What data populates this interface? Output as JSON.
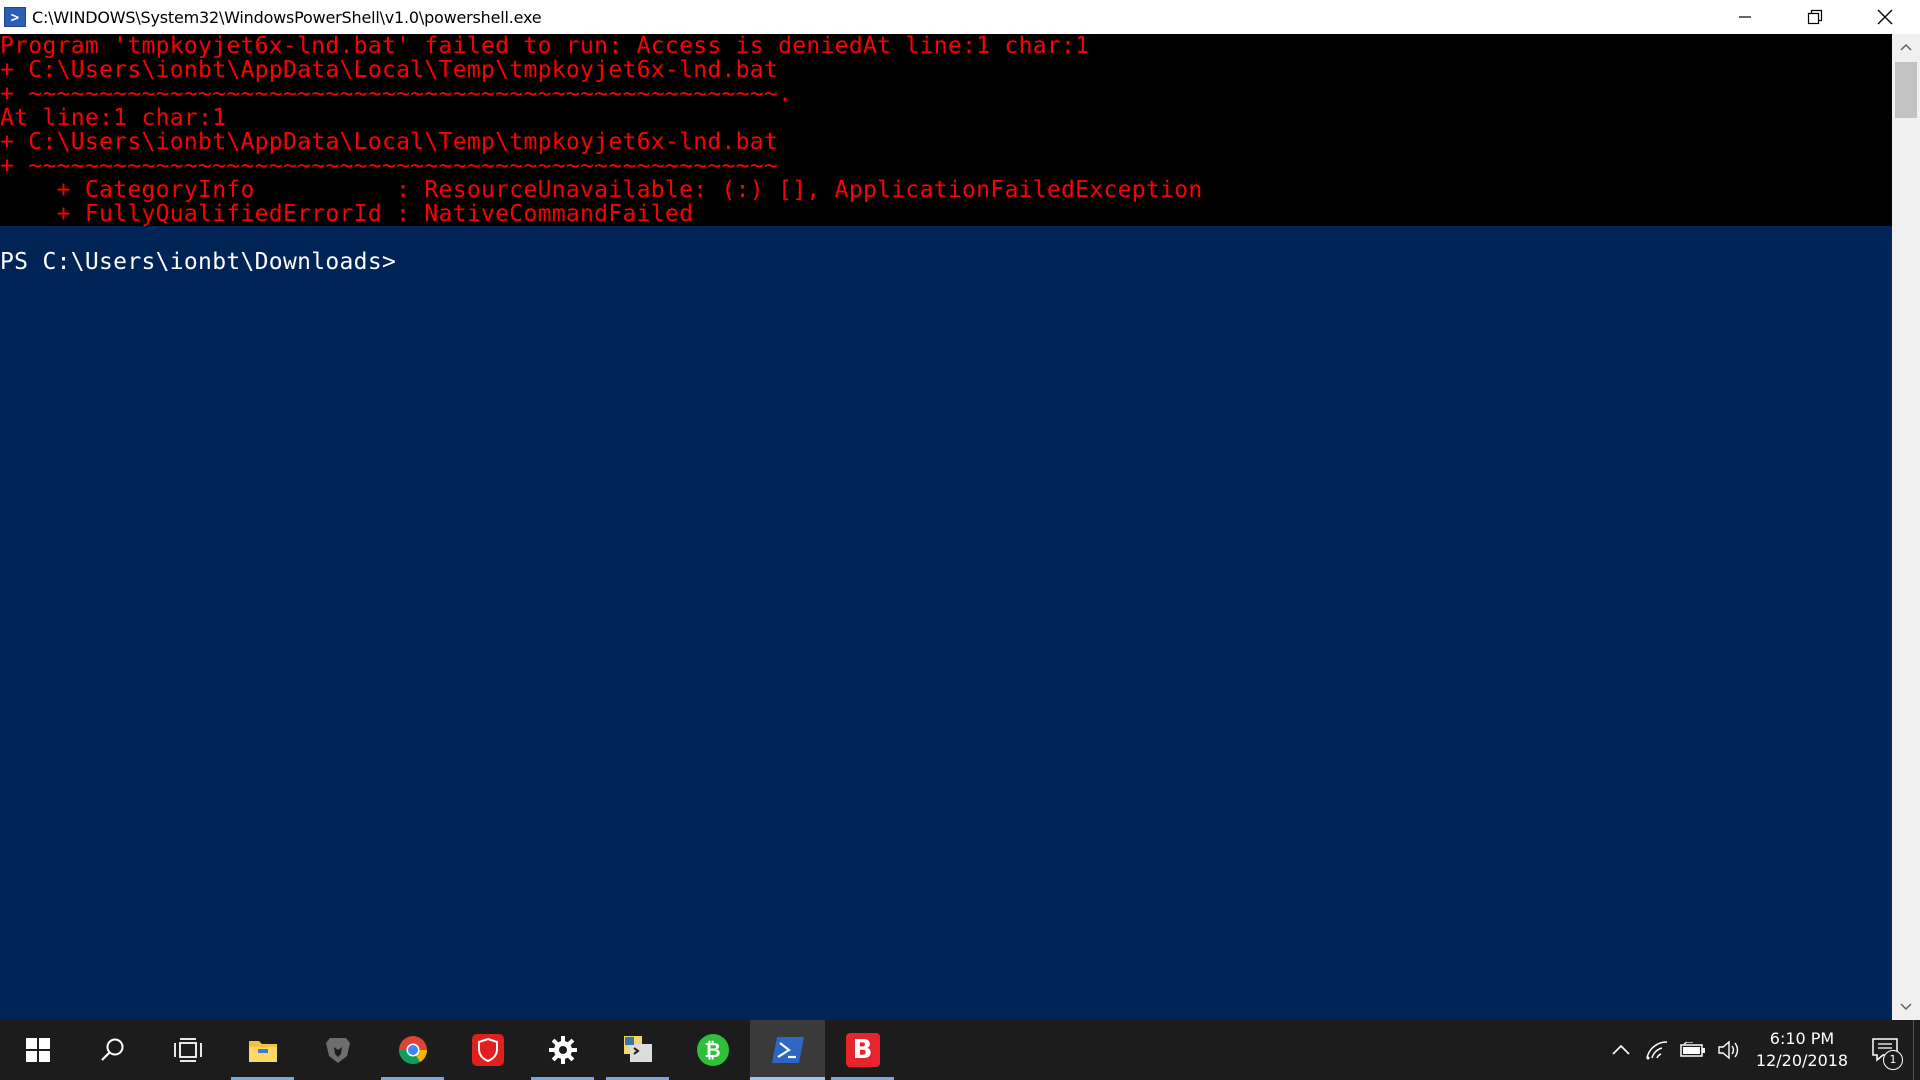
{
  "window": {
    "title": "C:\\WINDOWS\\System32\\WindowsPowerShell\\v1.0\\powershell.exe",
    "icon_glyph": ">"
  },
  "console": {
    "error_lines": [
      "Program 'tmpkoyjet6x-lnd.bat' failed to run: Access is deniedAt line:1 char:1",
      "+ C:\\Users\\ionbt\\AppData\\Local\\Temp\\tmpkoyjet6x-lnd.bat",
      "+ ~~~~~~~~~~~~~~~~~~~~~~~~~~~~~~~~~~~~~~~~~~~~~~~~~~~~~.",
      "At line:1 char:1",
      "+ C:\\Users\\ionbt\\AppData\\Local\\Temp\\tmpkoyjet6x-lnd.bat",
      "+ ~~~~~~~~~~~~~~~~~~~~~~~~~~~~~~~~~~~~~~~~~~~~~~~~~~~~~",
      "    + CategoryInfo          : ResourceUnavailable: (:) [], ApplicationFailedException",
      "    + FullyQualifiedErrorId : NativeCommandFailed"
    ],
    "prompt": "PS C:\\Users\\ionbt\\Downloads>"
  },
  "colors": {
    "console_bg": "#012456",
    "error_bg": "#000000",
    "error_fg": "#ff0000",
    "prompt_fg": "#ffffff",
    "taskbar_bg": "#1c1c1c"
  },
  "taskbar": {
    "items": [
      {
        "name": "start-button",
        "icon": "windows-logo-icon"
      },
      {
        "name": "search-button",
        "icon": "search-icon"
      },
      {
        "name": "task-view-button",
        "icon": "task-view-icon"
      },
      {
        "name": "file-explorer-button",
        "icon": "folder-icon"
      },
      {
        "name": "brave-button",
        "icon": "lion-icon"
      },
      {
        "name": "chrome-button",
        "icon": "chrome-icon"
      },
      {
        "name": "shield-app-button",
        "icon": "shield-icon"
      },
      {
        "name": "settings-button",
        "icon": "gear-icon"
      },
      {
        "name": "python-app-button",
        "icon": "python-icon"
      },
      {
        "name": "bitcoin-app-button",
        "icon": "bitcoin-icon"
      },
      {
        "name": "powershell-button",
        "icon": "powershell-icon"
      },
      {
        "name": "b-app-button",
        "icon": "b-letter-icon"
      }
    ],
    "b_letter": "B",
    "bitcoin_glyph": "₿",
    "clock_time": "6:10 PM",
    "clock_date": "12/20/2018",
    "notification_count": "1"
  }
}
